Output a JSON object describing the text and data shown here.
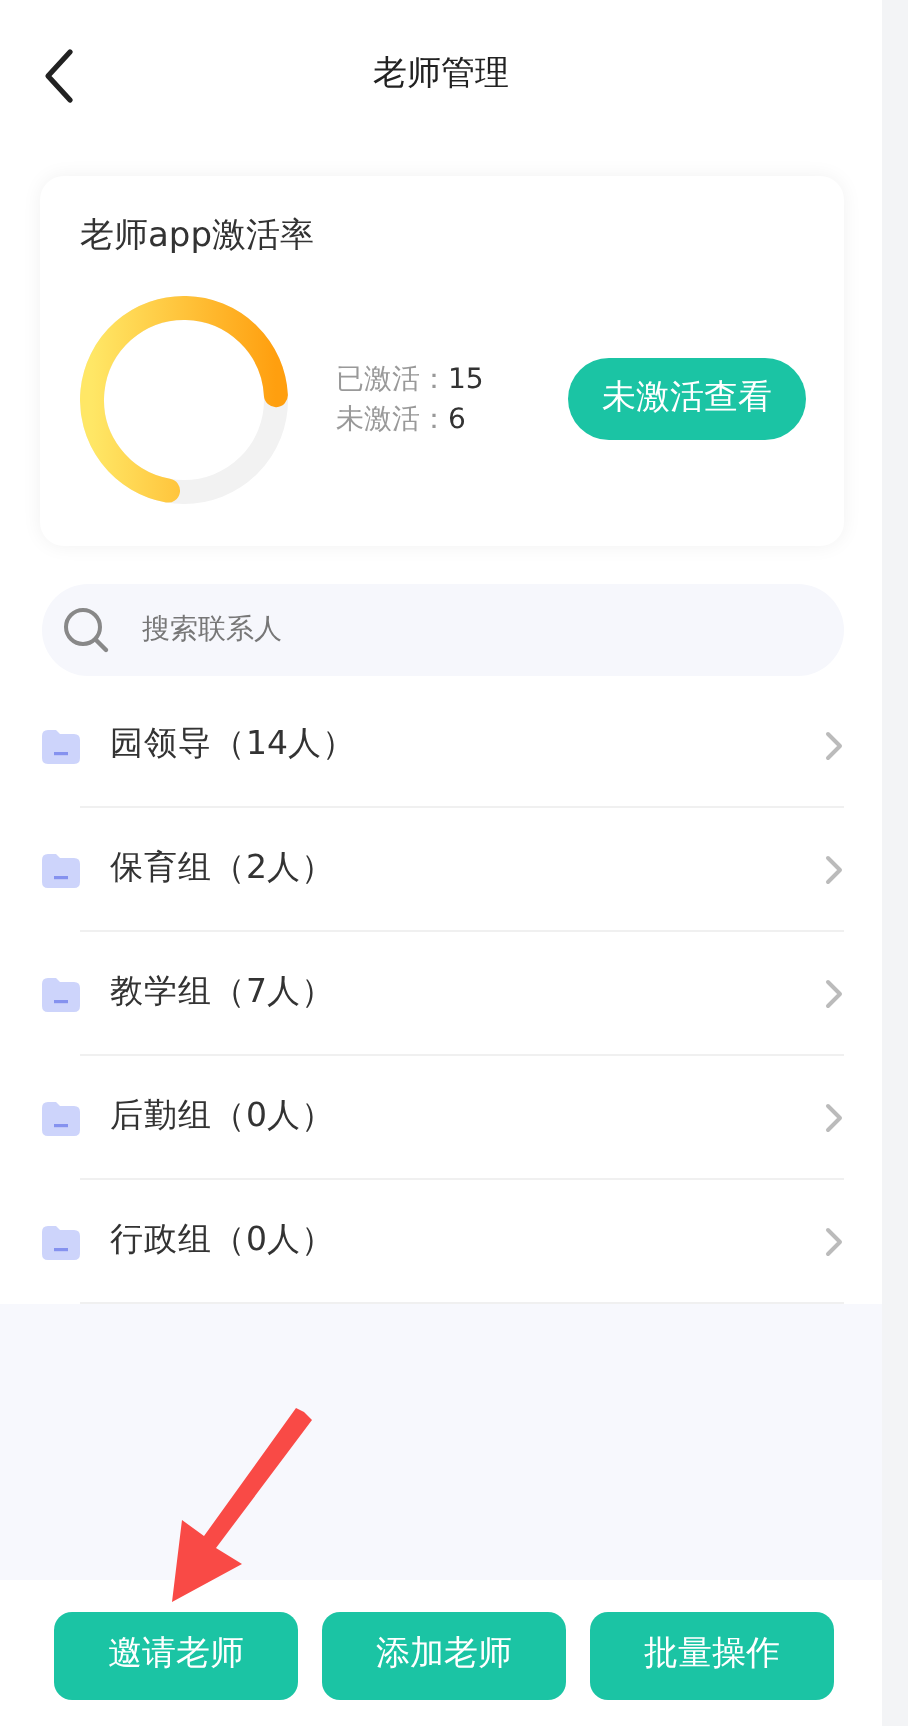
{
  "header": {
    "title": "老师管理"
  },
  "activation": {
    "title": "老师app激活率",
    "stats": [
      {
        "label": "已激活：",
        "value": "15"
      },
      {
        "label": "未激活：",
        "value": "6"
      }
    ],
    "button": "未激活查看"
  },
  "search": {
    "placeholder": "搜索联系人"
  },
  "groups": [
    {
      "label": "园领导（14人）"
    },
    {
      "label": "保育组（2人）"
    },
    {
      "label": "教学组（7人）"
    },
    {
      "label": "后勤组（0人）"
    },
    {
      "label": "行政组（0人）"
    }
  ],
  "actions": [
    "邀请老师",
    "添加老师",
    "批量操作"
  ]
}
